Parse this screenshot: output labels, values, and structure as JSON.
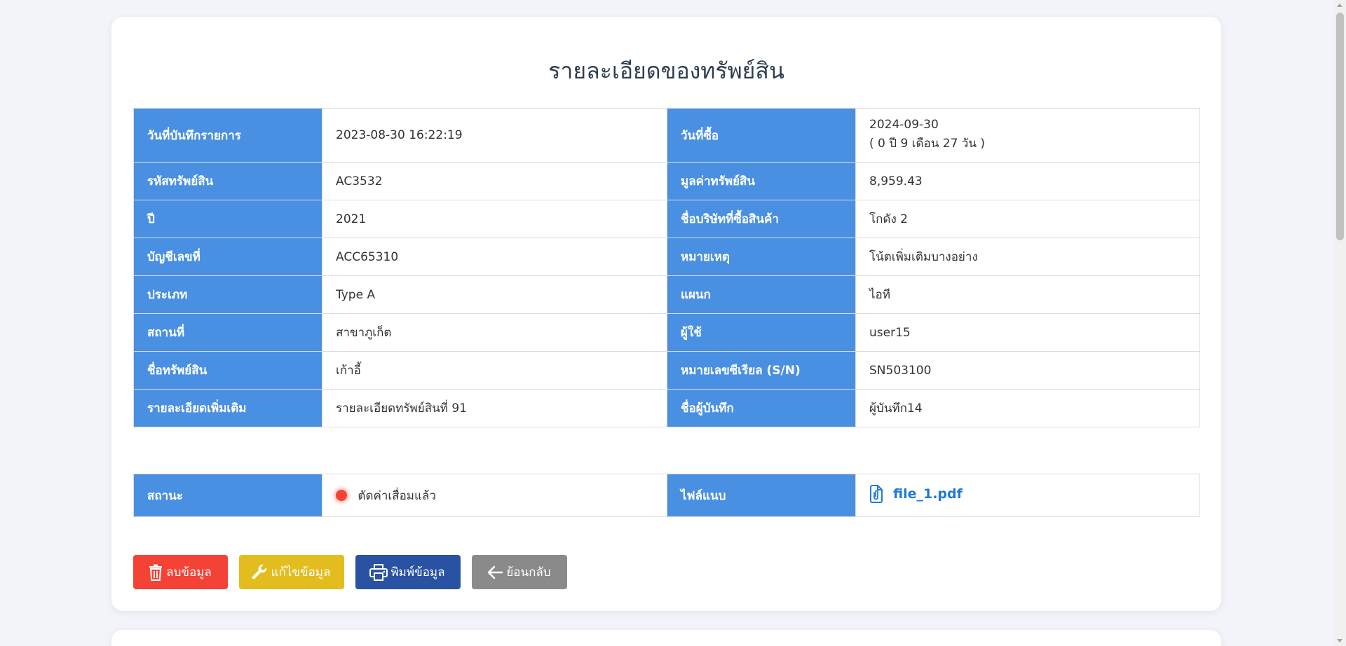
{
  "page": {
    "title": "รายละเอียดของทรัพย์สิน"
  },
  "details": {
    "rows": [
      {
        "l1": "วันที่บันทึกรายการ",
        "v1": "2023-08-30 16:22:19",
        "l2": "วันที่ซื้อ",
        "v2": "2024-09-30",
        "v2_sub": "( 0 ปี 9 เดือน 27 วัน )"
      },
      {
        "l1": "รหัสทรัพย์สิน",
        "v1": "AC3532",
        "l2": "มูลค่าทรัพย์สิน",
        "v2": "8,959.43"
      },
      {
        "l1": "ปี",
        "v1": "2021",
        "l2": "ชื่อบริษัทที่ซื้อสินค้า",
        "v2": "โกดัง 2"
      },
      {
        "l1": "บัญชีเลขที่",
        "v1": "ACC65310",
        "l2": "หมายเหตุ",
        "v2": "โน้ตเพิ่มเติมบางอย่าง"
      },
      {
        "l1": "ประเภท",
        "v1": "Type A",
        "l2": "แผนก",
        "v2": "ไอที"
      },
      {
        "l1": "สถานที่",
        "v1": "สาขาภูเก็ต",
        "l2": "ผู้ใช้",
        "v2": "user15"
      },
      {
        "l1": "ชื่อทรัพย์สิน",
        "v1": "เก้าอี้",
        "l2": "หมายเลขซีเรียล (S/N)",
        "v2": "SN503100"
      },
      {
        "l1": "รายละเอียดเพิ่มเติม",
        "v1": "รายละเอียดทรัพย์สินที่ 91",
        "l2": "ชื่อผู้บันทึก",
        "v2": "ผู้บันทึก14"
      }
    ]
  },
  "status": {
    "label": "สถานะ",
    "value": "ตัดค่าเสื่อมแล้ว",
    "color": "#f44336",
    "attachment_label": "ไฟล์แนบ",
    "file_name": "file_1.pdf",
    "file_icon": "paperclip-file-icon"
  },
  "actions": {
    "delete": "ลบข้อมูล",
    "edit": "แก้ไขข้อมูล",
    "print": "พิมพ์ข้อมูล",
    "back": "ย้อนกลับ"
  },
  "colors": {
    "header_cell": "#4a90e2",
    "delete": "#f44336",
    "edit": "#e3bd1e",
    "print": "#2a52a3",
    "back": "#8a8a8a",
    "link": "#1e7ad6"
  }
}
